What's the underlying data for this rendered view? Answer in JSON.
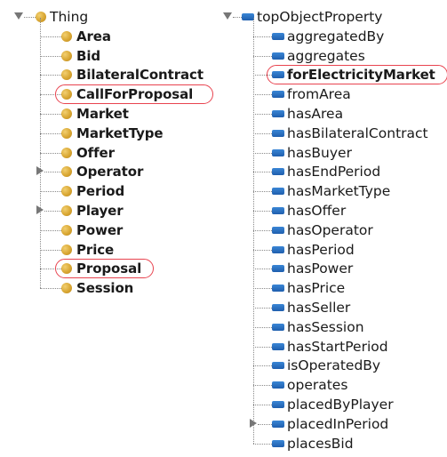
{
  "class_tree": {
    "root_label": "Thing",
    "items": [
      {
        "label": "Area",
        "expandable": false,
        "highlighted": false
      },
      {
        "label": "Bid",
        "expandable": false,
        "highlighted": false
      },
      {
        "label": "BilateralContract",
        "expandable": false,
        "highlighted": false
      },
      {
        "label": "CallForProposal",
        "expandable": false,
        "highlighted": true
      },
      {
        "label": "Market",
        "expandable": false,
        "highlighted": false
      },
      {
        "label": "MarketType",
        "expandable": false,
        "highlighted": false
      },
      {
        "label": "Offer",
        "expandable": false,
        "highlighted": false
      },
      {
        "label": "Operator",
        "expandable": true,
        "highlighted": false
      },
      {
        "label": "Period",
        "expandable": false,
        "highlighted": false
      },
      {
        "label": "Player",
        "expandable": true,
        "highlighted": false
      },
      {
        "label": "Power",
        "expandable": false,
        "highlighted": false
      },
      {
        "label": "Price",
        "expandable": false,
        "highlighted": false
      },
      {
        "label": "Proposal",
        "expandable": false,
        "highlighted": true
      },
      {
        "label": "Session",
        "expandable": false,
        "highlighted": false
      }
    ]
  },
  "property_tree": {
    "root_label": "topObjectProperty",
    "items": [
      {
        "label": "aggregatedBy",
        "expandable": false,
        "highlighted": false,
        "bold": false
      },
      {
        "label": "aggregates",
        "expandable": false,
        "highlighted": false,
        "bold": false
      },
      {
        "label": "forElectricityMarket",
        "expandable": false,
        "highlighted": true,
        "bold": true
      },
      {
        "label": "fromArea",
        "expandable": false,
        "highlighted": false,
        "bold": false
      },
      {
        "label": "hasArea",
        "expandable": false,
        "highlighted": false,
        "bold": false
      },
      {
        "label": "hasBilateralContract",
        "expandable": false,
        "highlighted": false,
        "bold": false
      },
      {
        "label": "hasBuyer",
        "expandable": false,
        "highlighted": false,
        "bold": false
      },
      {
        "label": "hasEndPeriod",
        "expandable": false,
        "highlighted": false,
        "bold": false
      },
      {
        "label": "hasMarketType",
        "expandable": false,
        "highlighted": false,
        "bold": false
      },
      {
        "label": "hasOffer",
        "expandable": false,
        "highlighted": false,
        "bold": false
      },
      {
        "label": "hasOperator",
        "expandable": false,
        "highlighted": false,
        "bold": false
      },
      {
        "label": "hasPeriod",
        "expandable": false,
        "highlighted": false,
        "bold": false
      },
      {
        "label": "hasPower",
        "expandable": false,
        "highlighted": false,
        "bold": false
      },
      {
        "label": "hasPrice",
        "expandable": false,
        "highlighted": false,
        "bold": false
      },
      {
        "label": "hasSeller",
        "expandable": false,
        "highlighted": false,
        "bold": false
      },
      {
        "label": "hasSession",
        "expandable": false,
        "highlighted": false,
        "bold": false
      },
      {
        "label": "hasStartPeriod",
        "expandable": false,
        "highlighted": false,
        "bold": false
      },
      {
        "label": "isOperatedBy",
        "expandable": false,
        "highlighted": false,
        "bold": false
      },
      {
        "label": "operates",
        "expandable": false,
        "highlighted": false,
        "bold": false
      },
      {
        "label": "placedByPlayer",
        "expandable": false,
        "highlighted": false,
        "bold": false
      },
      {
        "label": "placedInPeriod",
        "expandable": true,
        "highlighted": false,
        "bold": false
      },
      {
        "label": "placesBid",
        "expandable": false,
        "highlighted": false,
        "bold": false
      }
    ]
  },
  "colors": {
    "class_icon": "#d9a733",
    "property_icon": "#2a73c6",
    "highlight_outline": "#e8434f"
  },
  "icons": {
    "class_node": "class-circle-icon",
    "property_node": "object-property-bar-icon",
    "expanded": "triangle-down-icon",
    "collapsed": "triangle-right-icon"
  }
}
